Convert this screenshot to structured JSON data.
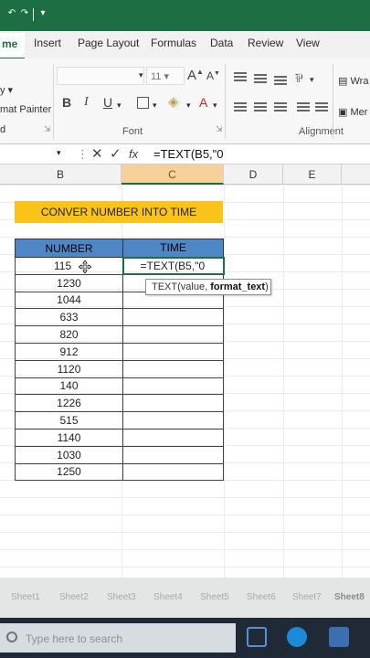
{
  "ribbon_tabs": [
    "me",
    "Insert",
    "Page Layout",
    "Formulas",
    "Data",
    "Review",
    "View"
  ],
  "ribbon": {
    "font_size": "11",
    "font_label": "Font",
    "alignment_label": "Alignment",
    "format_painter": "mat Painter",
    "wrap": "Wra",
    "merge": "Mer",
    "bold": "B",
    "italic": "I",
    "underline": "U"
  },
  "formula_bar": {
    "formula": "=TEXT(B5,\"0"
  },
  "columns": [
    "B",
    "C",
    "D",
    "E"
  ],
  "banner": "CONVER NUMBER INTO TIME",
  "table": {
    "headers": [
      "NUMBER",
      "TIME"
    ],
    "rows": [
      "1150",
      "1230",
      "1044",
      "633",
      "820",
      "912",
      "1120",
      "140",
      "1226",
      "515",
      "1140",
      "1030",
      "1250"
    ],
    "first_row_display": "115",
    "editing_cell": "=TEXT(B5,\"0"
  },
  "tooltip": {
    "text": "TEXT(value, ",
    "bold": "format_text",
    "close": ")"
  },
  "sheet_tabs": [
    "Sheet1",
    "Sheet2",
    "Sheet3",
    "Sheet4",
    "Sheet5",
    "Sheet6",
    "Sheet7",
    "Sheet8"
  ],
  "taskbar": {
    "search_placeholder": "Type here to search"
  },
  "colors": {
    "accent": "#1d6e43",
    "banner": "#f9c31a",
    "header": "#4f86c6",
    "selected_col": "#f6d29a"
  }
}
